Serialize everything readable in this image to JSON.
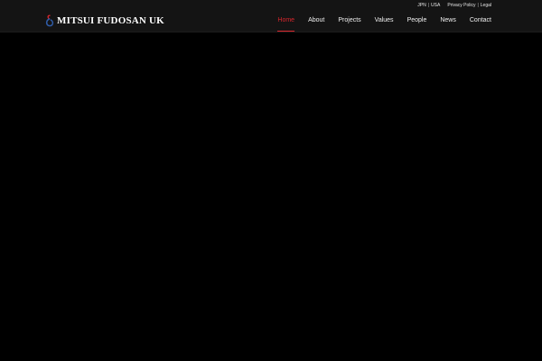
{
  "header": {
    "logo_text": "MITSUI FUDOSAN UK",
    "logo_icon": "mitsui-fudosan-logo-icon"
  },
  "utility": {
    "jpn": "JPN",
    "separator": "|",
    "usa": "USA",
    "privacy": "Privacy Policy",
    "legal": "Legal"
  },
  "nav": {
    "items": [
      {
        "label": "Home",
        "active": true
      },
      {
        "label": "About",
        "active": false
      },
      {
        "label": "Projects",
        "active": false
      },
      {
        "label": "Values",
        "active": false
      },
      {
        "label": "People",
        "active": false
      },
      {
        "label": "News",
        "active": false
      },
      {
        "label": "Contact",
        "active": false
      }
    ]
  },
  "colors": {
    "accent": "#d8262c",
    "header_bg": "#141414",
    "page_bg": "#000000",
    "logo_blue": "#2f5ca8"
  }
}
